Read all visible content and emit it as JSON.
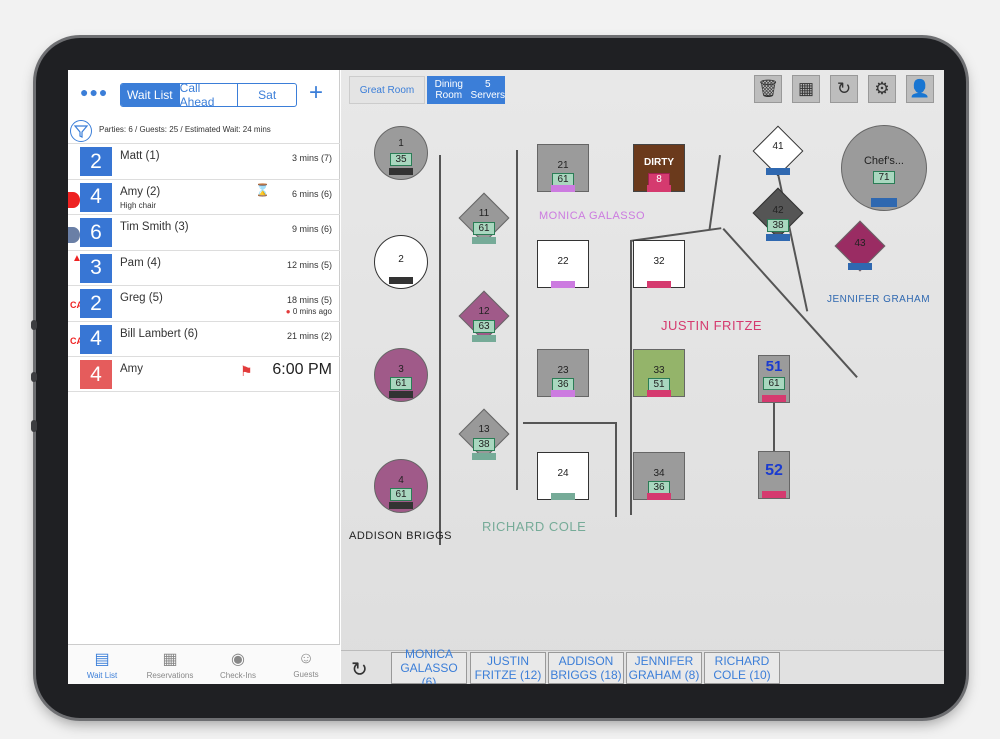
{
  "left": {
    "tabs": [
      "Wait List",
      "Call Ahead",
      "Sat"
    ],
    "summary": "Parties: 6 / Guests: 25 / Estimated Wait: 24 mins",
    "rows": [
      {
        "size": "2",
        "name": "Matt (1)",
        "wait": "3 mins (7)"
      },
      {
        "size": "4",
        "name": "Amy (2)",
        "note": "High chair",
        "wait": "6 mins (6)"
      },
      {
        "size": "6",
        "name": "Tim Smith (3)",
        "wait": "9 mins (6)"
      },
      {
        "size": "3",
        "name": "Pam (4)",
        "wait": "12 mins (5)"
      },
      {
        "size": "2",
        "name": "Greg (5)",
        "wait": "18 mins (5)",
        "wait2": "0 mins ago"
      },
      {
        "size": "4",
        "name": "Bill Lambert (6)",
        "wait": "21 mins (2)"
      },
      {
        "size": "4",
        "name": "Amy",
        "time": "6:00 PM"
      }
    ],
    "ca_label": "CA",
    "nav": [
      "Wait List",
      "Reservations",
      "Check-Ins",
      "Guests"
    ]
  },
  "floor": {
    "rooms": [
      "Great Room",
      "Dining Room",
      "5 Servers"
    ],
    "tables": {
      "t1": {
        "num": "1",
        "badge": "35"
      },
      "t2": {
        "num": "2"
      },
      "t3": {
        "num": "3",
        "badge": "61"
      },
      "t4": {
        "num": "4",
        "badge": "61"
      },
      "t11": {
        "num": "11",
        "badge": "61"
      },
      "t12": {
        "num": "12",
        "badge": "63"
      },
      "t13": {
        "num": "13",
        "badge": "38"
      },
      "t21": {
        "num": "21",
        "badge": "61"
      },
      "tdirty": {
        "num": "DIRTY",
        "badge": "8"
      },
      "t22": {
        "num": "22"
      },
      "t32": {
        "num": "32"
      },
      "t23": {
        "num": "23",
        "badge": "36"
      },
      "t33": {
        "num": "33",
        "badge": "51"
      },
      "t24": {
        "num": "24"
      },
      "t34": {
        "num": "34",
        "badge": "36"
      },
      "t41": {
        "num": "41"
      },
      "t42": {
        "num": "42",
        "badge": "38"
      },
      "t43": {
        "num": "43"
      },
      "tchef": {
        "num": "Chef's...",
        "badge": "71"
      },
      "t51": {
        "num": "51",
        "badge": "61"
      },
      "t52": {
        "num": "52"
      }
    },
    "servers": {
      "monica": "MONICA GALASSO",
      "justin": "JUSTIN FRITZE",
      "jennifer": "JENNIFER GRAHAM",
      "addison": "ADDISON BRIGGS",
      "richard": "RICHARD COLE"
    },
    "server_buttons": [
      {
        "l1": "MONICA",
        "l2": "GALASSO (6)"
      },
      {
        "l1": "JUSTIN",
        "l2": "FRITZE (12)"
      },
      {
        "l1": "ADDISON",
        "l2": "BRIGGS (18)"
      },
      {
        "l1": "JENNIFER",
        "l2": "GRAHAM (8)"
      },
      {
        "l1": "RICHARD",
        "l2": "COLE (10)"
      }
    ]
  },
  "colors": {
    "accent": "#3b7ed8",
    "monica": "#cc7be0",
    "justin": "#d53a6f",
    "jennifer": "#2f68b0",
    "richard": "#76ab98",
    "addison": "#222222"
  }
}
